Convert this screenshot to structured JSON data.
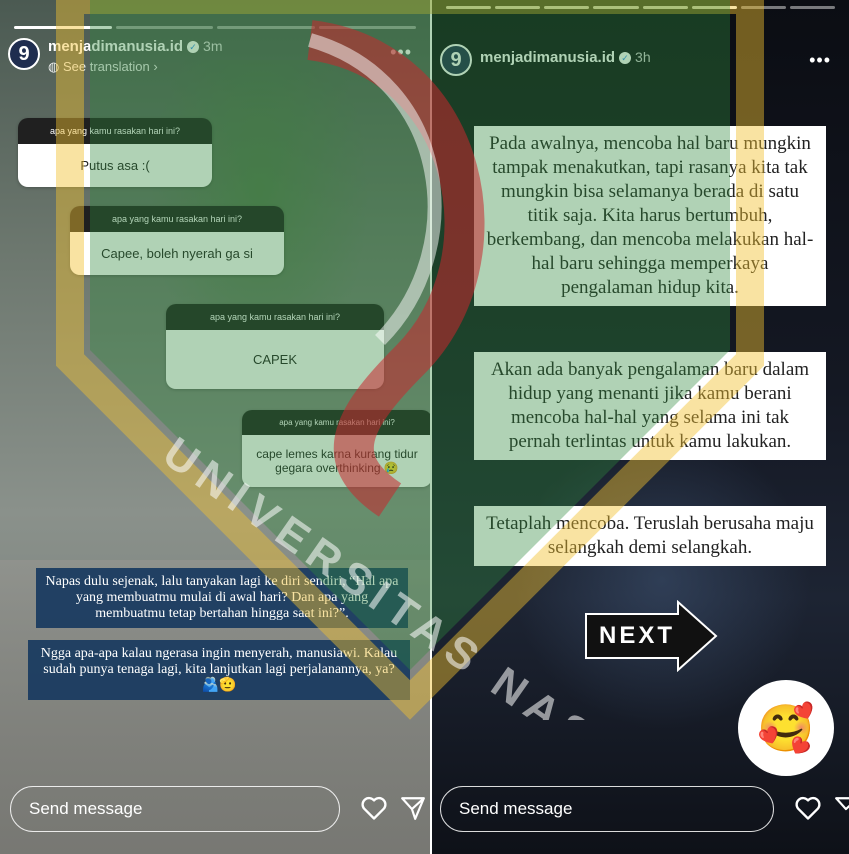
{
  "left_story": {
    "username": "menjadimanusia.id",
    "time": "3m",
    "see_translation": "See translation",
    "progress_total": 4,
    "progress_done": 1,
    "questions": [
      {
        "question": "apa yang kamu rasakan hari ini?",
        "answer": "Putus asa :("
      },
      {
        "question": "apa yang kamu rasakan hari ini?",
        "answer": "Capee, boleh nyerah ga si"
      },
      {
        "question": "apa yang kamu rasakan hari ini?",
        "answer": "CAPEK"
      },
      {
        "question": "apa yang kamu rasakan hari ini?",
        "answer": "cape lemes karna kurang tidur gegara overthinking 😢"
      }
    ],
    "caption_1": "Napas dulu sejenak, lalu tanyakan lagi ke diri sendiri, “Hal apa yang membuatmu mulai di awal hari? Dan apa yang membuatmu tetap bertahan hingga saat ini?”.",
    "caption_2": "Ngga apa-apa kalau ngerasa ingin menyerah, manusiawi. Kalau sudah punya tenaga lagi, kita lanjutkan lagi perjalanannya, ya?🫂🫡",
    "send_message_placeholder": "Send message"
  },
  "right_story": {
    "username": "menjadimanusia.id",
    "time": "3h",
    "progress_total": 8,
    "progress_done": 6,
    "paragraph_1": "Pada awalnya, mencoba hal baru mungkin tampak menakutkan, tapi rasanya kita tak mungkin bisa selamanya berada di satu titik saja. Kita harus bertumbuh, berkembang, dan mencoba melakukan hal-hal baru sehingga memperkaya pengalaman hidup kita.",
    "paragraph_2": "Akan ada banyak pengalaman baru dalam hidup yang menanti jika kamu berani mencoba hal-hal yang selama ini tak pernah terlintas untuk kamu lakukan.",
    "paragraph_3": "Tetaplah mencoba. Teruslah berusaha maju selangkah demi selangkah.",
    "next_label": "NEXT",
    "reaction_emoji": "🥰",
    "send_message_placeholder": "Send message"
  },
  "watermark": {
    "text": "UNIVERSITAS NASIONAL",
    "colors": {
      "green": "#2f8a3c",
      "red": "#c8282e",
      "yellow": "#f2c230"
    }
  },
  "icons": {
    "more": "more-icon",
    "heart": "heart-icon",
    "send": "send-icon",
    "verified": "verified-badge-icon",
    "globe": "globe-icon",
    "next_arrow": "next-arrow-icon"
  }
}
